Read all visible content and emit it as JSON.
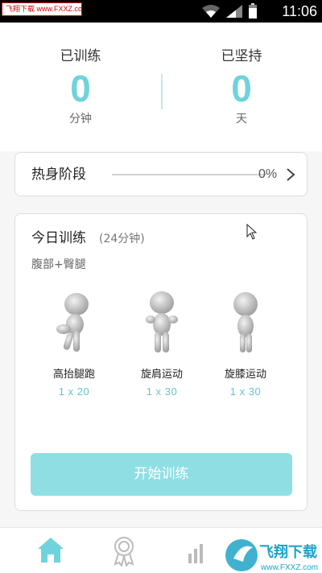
{
  "status_bar": {
    "watermark": "飞翔下载 www.FXXZ.com",
    "time": "11:06"
  },
  "stats": {
    "trained": {
      "label": "已训练",
      "value": "0",
      "unit": "分钟"
    },
    "persisted": {
      "label": "已坚持",
      "value": "0",
      "unit": "天"
    }
  },
  "warmup": {
    "title": "热身阶段",
    "progress_text": "0%",
    "progress": 0
  },
  "today": {
    "title": "今日训练",
    "duration": "(24分钟)",
    "subtitle": "腹部+臀腿",
    "exercises": [
      {
        "name": "高抬腿跑",
        "reps": "1 x 20"
      },
      {
        "name": "旋肩运动",
        "reps": "1 x 30"
      },
      {
        "name": "旋膝运动",
        "reps": "1 x 30"
      }
    ],
    "start_label": "开始训练"
  },
  "bottom_nav": {
    "items": [
      {
        "icon": "home-icon",
        "active": true
      },
      {
        "icon": "award-icon",
        "active": false
      },
      {
        "icon": "stats-icon",
        "active": false
      }
    ]
  },
  "bottom_watermark": {
    "logo_text": "飞翔下载",
    "url": "www.FXXZ.com"
  },
  "colors": {
    "accent": "#6fd3db",
    "button": "#8edfe3",
    "reps": "#5fc6d0"
  }
}
